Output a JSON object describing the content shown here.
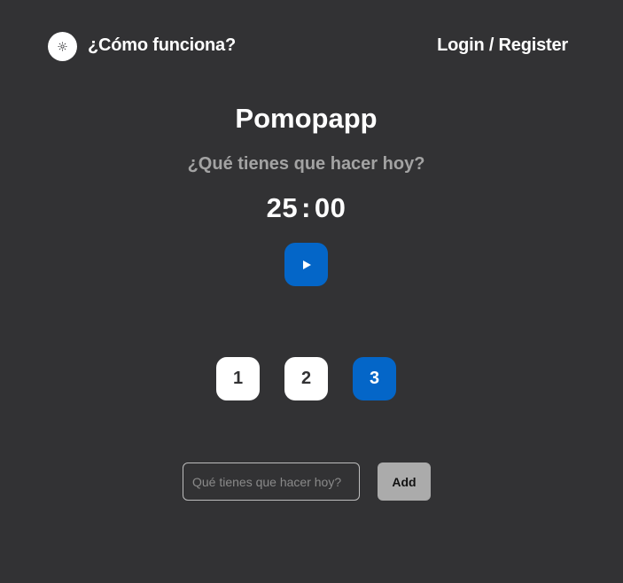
{
  "header": {
    "theme_icon": "sun-icon",
    "how_it_works": "¿Cómo funciona?",
    "login_register": "Login / Register"
  },
  "main": {
    "title": "Pomopapp",
    "subtitle": "¿Qué tienes que hacer hoy?",
    "timer": {
      "minutes": "25",
      "separator": ":",
      "seconds": "00"
    },
    "play_icon": "play-icon"
  },
  "sessions": {
    "options": [
      "1",
      "2",
      "3"
    ],
    "selected": "3"
  },
  "task_form": {
    "placeholder": "Qué tienes que hacer hoy?",
    "value": "",
    "add_label": "Add"
  },
  "colors": {
    "background": "#323234",
    "accent": "#0466c8",
    "subtitle": "#a3a3a3",
    "add_button": "#ababab"
  }
}
